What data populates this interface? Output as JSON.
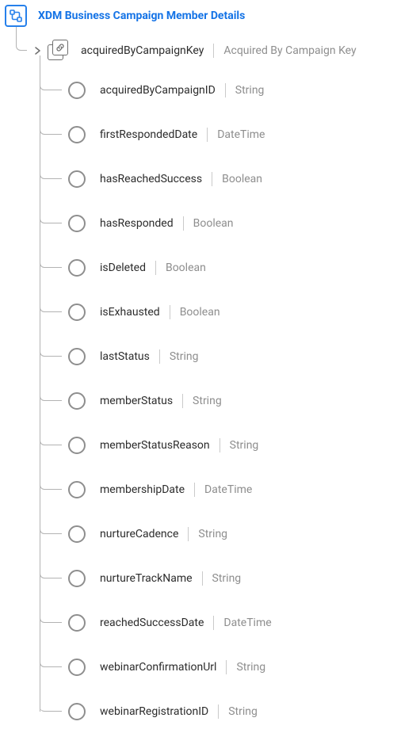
{
  "root": {
    "title": "XDM Business Campaign Member Details"
  },
  "firstLevel": {
    "name": "acquiredByCampaignKey",
    "type": "Acquired By Campaign Key"
  },
  "fields": [
    {
      "name": "acquiredByCampaignID",
      "type": "String"
    },
    {
      "name": "firstRespondedDate",
      "type": "DateTime"
    },
    {
      "name": "hasReachedSuccess",
      "type": "Boolean"
    },
    {
      "name": "hasResponded",
      "type": "Boolean"
    },
    {
      "name": "isDeleted",
      "type": "Boolean"
    },
    {
      "name": "isExhausted",
      "type": "Boolean"
    },
    {
      "name": "lastStatus",
      "type": "String"
    },
    {
      "name": "memberStatus",
      "type": "String"
    },
    {
      "name": "memberStatusReason",
      "type": "String"
    },
    {
      "name": "membershipDate",
      "type": "DateTime"
    },
    {
      "name": "nurtureCadence",
      "type": "String"
    },
    {
      "name": "nurtureTrackName",
      "type": "String"
    },
    {
      "name": "reachedSuccessDate",
      "type": "DateTime"
    },
    {
      "name": "webinarConfirmationUrl",
      "type": "String"
    },
    {
      "name": "webinarRegistrationID",
      "type": "String"
    }
  ]
}
